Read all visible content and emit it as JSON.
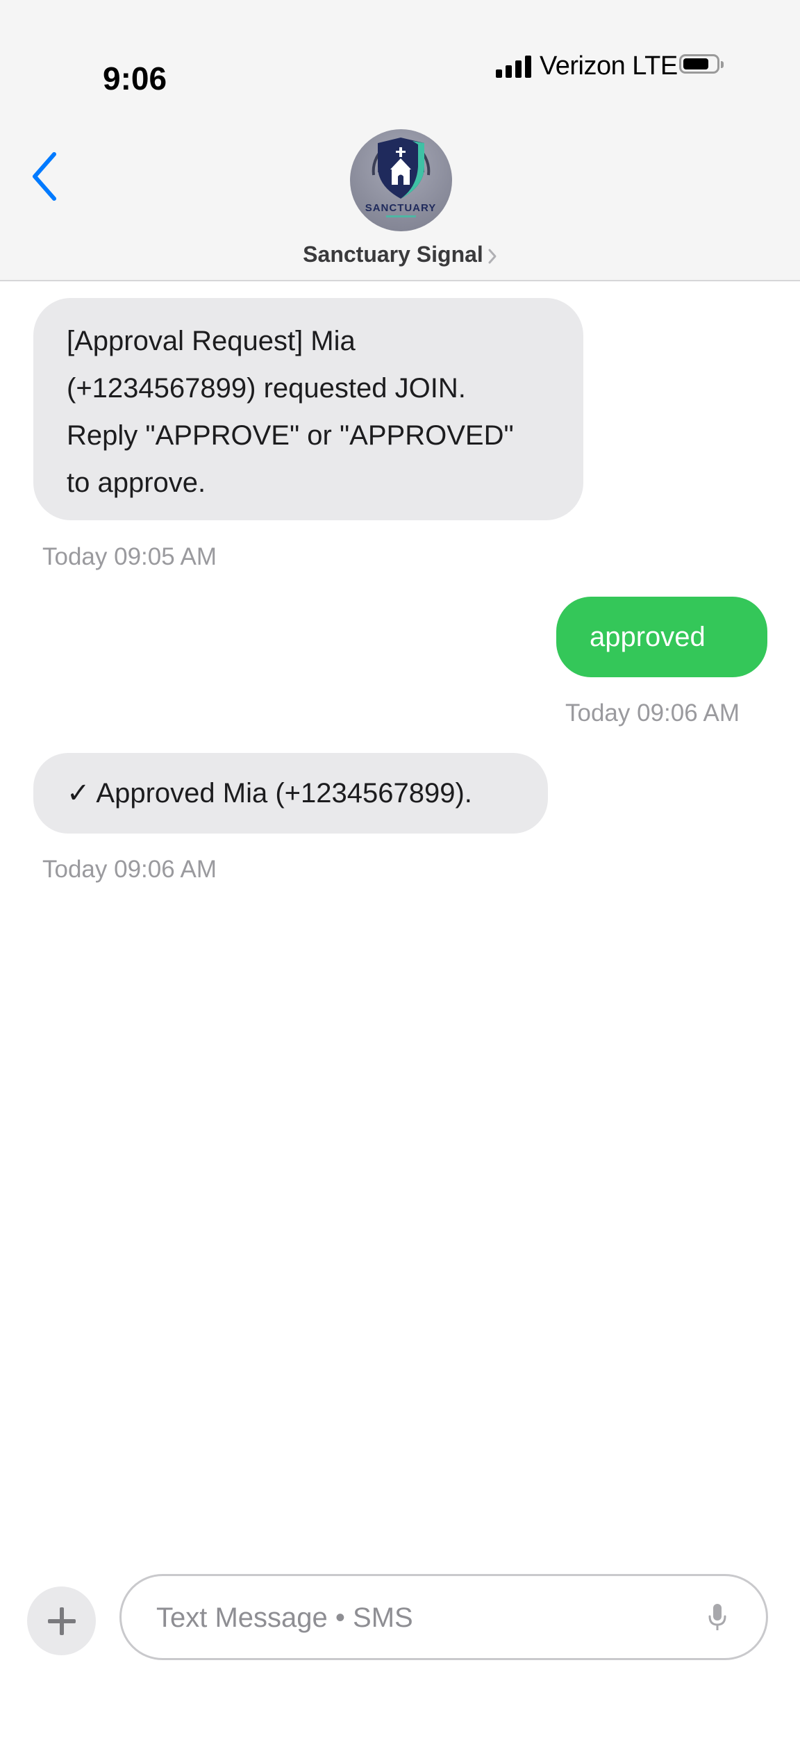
{
  "status_bar": {
    "time": "9:06",
    "carrier": "Verizon LTE",
    "icons": [
      "signal-bars-icon",
      "battery-icon"
    ]
  },
  "header": {
    "back_icon": "chevron-left-icon",
    "contact_name": "Sanctuary Signal",
    "avatar_text": "SANCTUARY",
    "disclosure_icon": "chevron-right-icon"
  },
  "messages": [
    {
      "direction": "incoming",
      "lines": [
        "[Approval Request] Mia",
        "(+1234567899) requested JOIN.",
        "Reply \"APPROVE\" or \"APPROVED\"",
        "to approve."
      ],
      "timestamp": "Today 09:05 AM"
    },
    {
      "direction": "outgoing",
      "text": "approved",
      "timestamp": "Today 09:06 AM"
    },
    {
      "direction": "incoming",
      "text": "✓ Approved Mia (+1234567899).",
      "timestamp": "Today 09:06 AM"
    }
  ],
  "composer": {
    "placeholder": "Text Message • SMS",
    "value": "",
    "icons": [
      "plus-icon",
      "microphone-icon"
    ]
  },
  "colors": {
    "accent": "#007aff",
    "incoming_bubble": "#e9e9eb",
    "outgoing_bubble": "#34c759",
    "header_bg": "#f5f5f5",
    "timestamp": "#9a9a9e"
  }
}
